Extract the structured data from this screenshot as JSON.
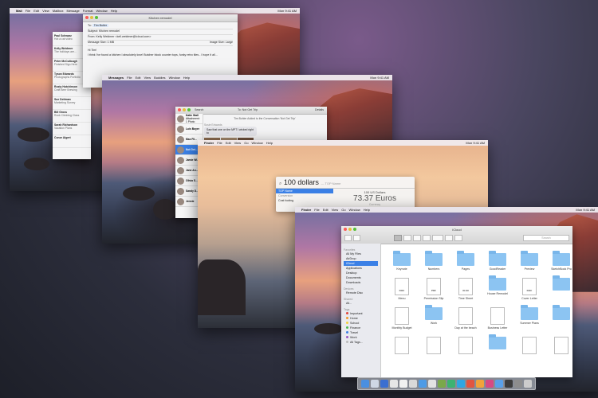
{
  "screen1": {
    "menubar": {
      "app": "Mail",
      "items": [
        "File",
        "Edit",
        "View",
        "Mailbox",
        "Message",
        "Format",
        "Window",
        "Help"
      ],
      "clock": "Mon 9:41 AM"
    },
    "compose": {
      "title": "Kitchen remodel",
      "to_label": "To:",
      "to_value": "Tim Butler",
      "subject_label": "Subject:",
      "subject_value": "Kitchen remodel",
      "from_label": "From:",
      "from_value": "Kelly Weidmer <kell.weidmer@icloud.com>",
      "size_label": "Message Size:",
      "size_value": "1 MB",
      "image_size_label": "Image Size:",
      "image_size_value": "Large",
      "greeting": "Hi Tim!",
      "body": "I think I've found a kitchen I absolutely love! Butcher block counter tops, funky retro tiles - I hope it all..."
    },
    "inbox": [
      {
        "name": "Paul Schwarz",
        "preview": "Hot a cat video"
      },
      {
        "name": "Kelly Weidmer",
        "preview": "The holidays are..."
      },
      {
        "name": "Peter McCullough",
        "preview": "Finished Sign Here"
      },
      {
        "name": "Tyson Edwards",
        "preview": "Photographs Portfolio"
      },
      {
        "name": "Rusty Hutchinson",
        "preview": "Craft Beer Brewing"
      },
      {
        "name": "Sue Dettman",
        "preview": "Marketing Survey"
      },
      {
        "name": "Bill Gross",
        "preview": "Rock Climbing Class"
      },
      {
        "name": "Sarah Richardson",
        "preview": "Vacation Plans"
      },
      {
        "name": "Conor Algert",
        "preview": ""
      }
    ]
  },
  "screen2": {
    "menubar": {
      "app": "Messages",
      "items": [
        "File",
        "Edit",
        "View",
        "Buddies",
        "Window",
        "Help"
      ],
      "clock": "Mon 9:41 AM"
    },
    "search_placeholder": "Search",
    "header_to": "To:",
    "header_to_value": "Not Get Trip",
    "details": "Details",
    "conversations": [
      {
        "name": "Katie Stall",
        "preview": "Attachment: 1 Photo"
      },
      {
        "name": "Luis Boyer",
        "preview": ""
      },
      {
        "name": "Max Fil...",
        "preview": ""
      },
      {
        "name": "Not Get...",
        "preview": ""
      },
      {
        "name": "Jamie Wi...",
        "preview": ""
      },
      {
        "name": "Jane An...",
        "preview": ""
      },
      {
        "name": "Olivia S...",
        "preview": ""
      },
      {
        "name": "Sandy D...",
        "preview": ""
      },
      {
        "name": "Jennie",
        "preview": ""
      }
    ],
    "thread_name": "Susie Edwards",
    "thread_bubble": "Saw that one on the MPT I wicked right to",
    "thread_header": "Tim Buhler Added to the Conversation 'Not Get Trip'"
  },
  "screen3": {
    "menubar": {
      "app": "Finder",
      "items": [
        "File",
        "Edit",
        "View",
        "Go",
        "Window",
        "Help"
      ],
      "clock": "Mon 9:41 AM"
    },
    "spotlight": {
      "query": "100 dollars",
      "hint": "— TOP Name",
      "result_selected": "TOP Name",
      "result_section": "Conversion",
      "conversion_source": "100 US Dollars",
      "conversion_value": "73.37 Euros",
      "conversion_detail": "Currency",
      "second_result": "Cost footing"
    }
  },
  "screen4": {
    "menubar": {
      "app": "Finder",
      "items": [
        "File",
        "Edit",
        "View",
        "Go",
        "Window",
        "Help"
      ],
      "clock": "Mon 9:41 AM"
    },
    "finder": {
      "title": "iCloud",
      "search_placeholder": "Search",
      "sidebar": {
        "favorites_header": "Favorites",
        "favorites": [
          "All My Files",
          "AirDrop",
          "iCloud",
          "Applications",
          "Desktop",
          "Documents",
          "Downloads"
        ],
        "devices_header": "Devices",
        "devices": [
          "Remote Disc"
        ],
        "shared_header": "Shared",
        "shared": [
          "All..."
        ],
        "tags_header": "Tags",
        "tags": [
          {
            "label": "Important",
            "color": "#e0453c"
          },
          {
            "label": "Home",
            "color": "#f39a2a"
          },
          {
            "label": "School",
            "color": "#f4cf3b"
          },
          {
            "label": "Finance",
            "color": "#4cb851"
          },
          {
            "label": "Travel",
            "color": "#3b80e6"
          },
          {
            "label": "Work",
            "color": "#9b59c6"
          },
          {
            "label": "All Tags...",
            "color": "#bbbbbb"
          }
        ]
      },
      "items": [
        {
          "label": "Keynote",
          "kind": "folder"
        },
        {
          "label": "Numbers",
          "kind": "folder"
        },
        {
          "label": "Pages",
          "kind": "folder"
        },
        {
          "label": "GoodReader",
          "kind": "folder"
        },
        {
          "label": "Preview",
          "kind": "folder"
        },
        {
          "label": "SketchBook Pro",
          "kind": "folder"
        },
        {
          "label": "Menu",
          "kind": "doc",
          "badge": "DOC"
        },
        {
          "label": "Permission Slip",
          "kind": "doc",
          "badge": "PDF"
        },
        {
          "label": "Time Sheet",
          "kind": "doc",
          "badge": "XLSX"
        },
        {
          "label": "House Remodel",
          "kind": "folder"
        },
        {
          "label": "Cover Letter",
          "kind": "doc",
          "badge": "DOC"
        },
        {
          "label": "",
          "kind": "folder"
        },
        {
          "label": "Monthly Budget",
          "kind": "doc",
          "badge": ""
        },
        {
          "label": "Work",
          "kind": "folder"
        },
        {
          "label": "Day at the beach",
          "kind": "doc",
          "badge": ""
        },
        {
          "label": "Business Letter",
          "kind": "doc",
          "badge": ""
        },
        {
          "label": "Summer Plans",
          "kind": "folder"
        },
        {
          "label": "",
          "kind": "folder"
        },
        {
          "label": "",
          "kind": "doc",
          "badge": ""
        },
        {
          "label": "",
          "kind": "doc",
          "badge": ""
        },
        {
          "label": "",
          "kind": "doc",
          "badge": ""
        },
        {
          "label": "",
          "kind": "folder"
        },
        {
          "label": "",
          "kind": "doc",
          "badge": ""
        },
        {
          "label": "",
          "kind": "doc",
          "badge": ""
        }
      ]
    },
    "dock_colors": [
      "#4a8fe0",
      "#cfd7e4",
      "#3b6fd1",
      "#e6e6e6",
      "#f1f1f1",
      "#d9d9d9",
      "#4d9be6",
      "#e2e2e2",
      "#7aa84a",
      "#3cb371",
      "#2fa6e2",
      "#e25540",
      "#f2a33a",
      "#d64a84",
      "#5aa0e8",
      "#3d3d3d",
      "#8d8d8d",
      "#cccccc"
    ]
  }
}
